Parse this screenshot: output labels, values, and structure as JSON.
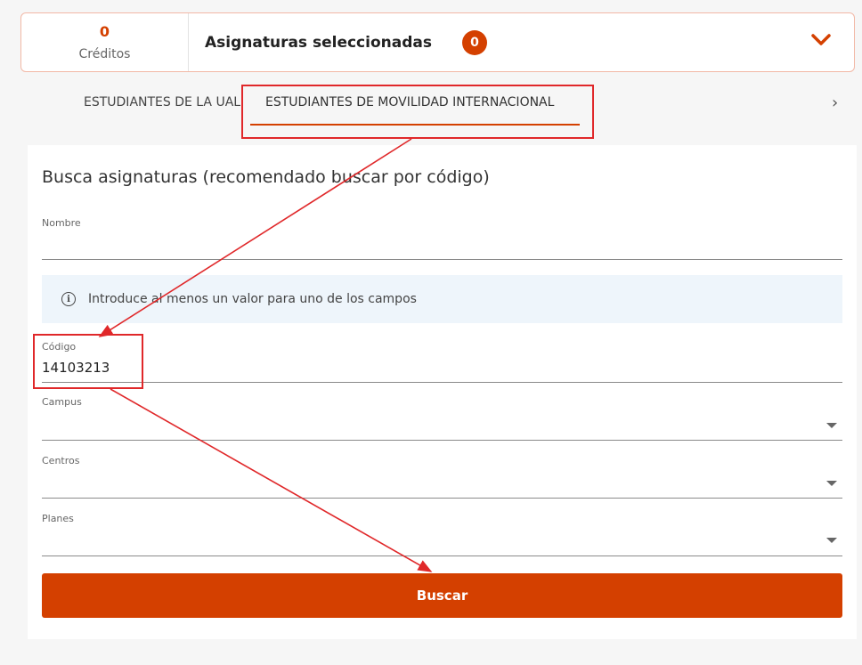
{
  "summary": {
    "credits_value": "0",
    "credits_label": "Créditos",
    "selected_title": "Asignaturas seleccionadas",
    "selected_count": "0"
  },
  "tabs": [
    {
      "label": "ESTUDIANTES DE LA UAL",
      "active": false
    },
    {
      "label": "ESTUDIANTES DE MOVILIDAD INTERNACIONAL",
      "active": true
    }
  ],
  "tab_next_glyph": "›",
  "form": {
    "title": "Busca asignaturas (recomendado buscar por código)",
    "nombre": {
      "label": "Nombre",
      "value": ""
    },
    "info_text": "Introduce al menos un valor para uno de los campos",
    "codigo": {
      "label": "Código",
      "value": "14103213"
    },
    "campus": {
      "label": "Campus",
      "value": ""
    },
    "centros": {
      "label": "Centros",
      "value": ""
    },
    "planes": {
      "label": "Planes",
      "value": ""
    },
    "button_label": "Buscar"
  },
  "colors": {
    "accent": "#d44000",
    "annotation": "#e0282a",
    "info_bg": "#eef5fb"
  },
  "icons": [
    "chevron-down-icon",
    "chevron-right-icon",
    "info-icon",
    "dropdown-arrow-icon"
  ]
}
